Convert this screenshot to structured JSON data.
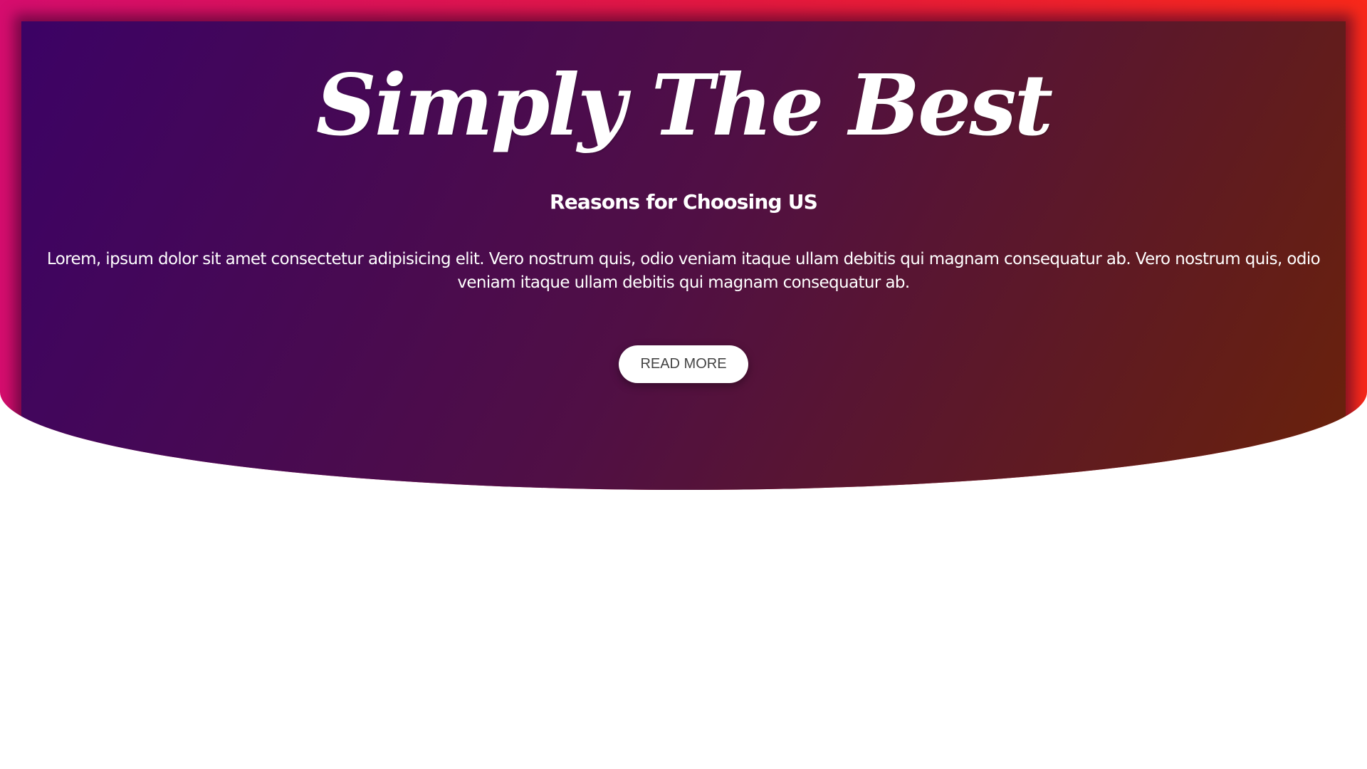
{
  "hero": {
    "title": "Simply The Best",
    "subtitle": "Reasons for Choosing US",
    "body": "Lorem, ipsum dolor sit amet consectetur adipisicing elit. Vero nostrum quis, odio veniam itaque ullam debitis qui magnam consequatur ab. Vero nostrum quis, odio veniam itaque ullam debitis qui magnam consequatur ab.",
    "button_label": "READ MORE"
  },
  "colors": {
    "frame_start": "#d60d6e",
    "frame_end": "#f8281a",
    "panel_start": "#3c0265",
    "panel_end": "#6b2307",
    "text": "#ffffff",
    "button_background": "#ffffff",
    "button_text": "#444444"
  }
}
